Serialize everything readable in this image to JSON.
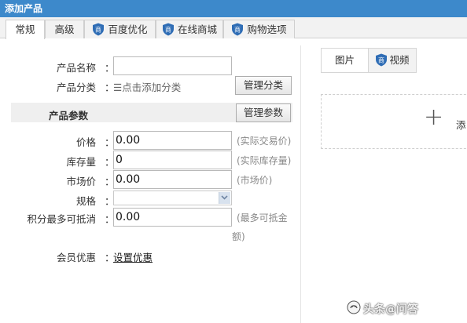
{
  "window": {
    "title": "添加产品"
  },
  "tabs": [
    {
      "label": "常规",
      "active": true,
      "icon": null
    },
    {
      "label": "高级",
      "active": false,
      "icon": null
    },
    {
      "label": "百度优化",
      "active": false,
      "icon": "shield-icon"
    },
    {
      "label": "在线商城",
      "active": false,
      "icon": "shield-icon"
    },
    {
      "label": "购物选项",
      "active": false,
      "icon": "shield-icon"
    }
  ],
  "shield_glyph": "商",
  "colors": {
    "titlebar": "#3d89cb",
    "shield": "#2f6db5",
    "section_bg": "#efefef"
  },
  "form": {
    "colon": "：",
    "name_label": "产品名称",
    "name_value": "",
    "category_label": "产品分类",
    "category_link": "☰点击添加分类",
    "manage_category_button": "管理分类",
    "params_section_title": "产品参数",
    "manage_params_button": "管理参数",
    "price_label": "价格",
    "price_value": "0.00",
    "price_hint": "(实际交易价)",
    "stock_label": "库存量",
    "stock_value": "0",
    "stock_hint": "(实际库存量)",
    "market_price_label": "市场价",
    "market_price_value": "0.00",
    "market_price_hint": "(市场价)",
    "spec_label": "规格",
    "spec_value": "",
    "points_label": "积分最多可抵消",
    "points_value": "0.00",
    "points_hint_line1": "(最多可抵金",
    "points_hint_line2": "额)",
    "member_label": "会员优惠",
    "member_link": "设置优惠"
  },
  "media": {
    "image_tab": "图片",
    "video_tab": "视频",
    "upload_plus": "+",
    "upload_text": "添"
  },
  "watermark": {
    "text": "头条@问答",
    "icon": "toutiao-logo-icon"
  }
}
